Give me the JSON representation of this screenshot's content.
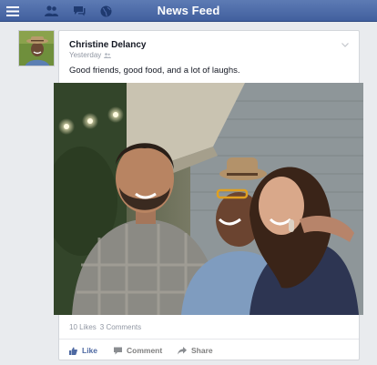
{
  "header": {
    "title": "News Feed",
    "menu_icon": "hamburger-menu-icon",
    "friends_icon": "friend-requests-icon",
    "messages_icon": "messages-icon",
    "notifications_icon": "notifications-globe-icon"
  },
  "post": {
    "author": "Christine Delancy",
    "timestamp": "Yesterday",
    "audience_icon": "friends-audience-icon",
    "text": "Good friends, good food, and a lot of laughs.",
    "likes": "10 Likes",
    "comments": "3 Comments",
    "actions": {
      "like": "Like",
      "comment": "Comment",
      "share": "Share"
    }
  },
  "colors": {
    "header_bar": "#4b67a6",
    "page_background": "#e9ebee",
    "like_blue": "#4e69a2",
    "muted_text": "#9197a3"
  }
}
